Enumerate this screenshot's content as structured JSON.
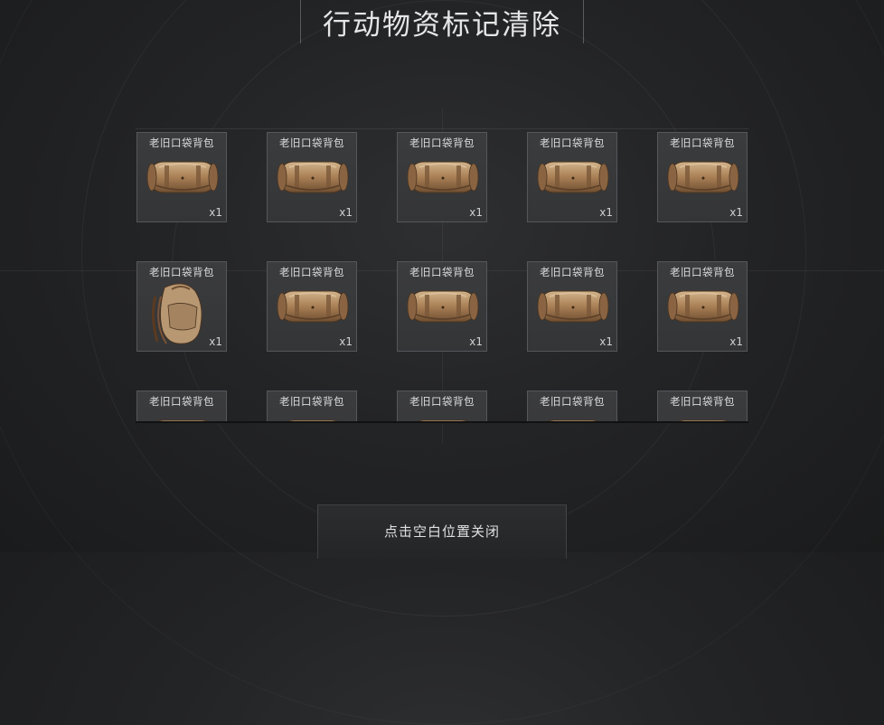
{
  "header": {
    "title": "行动物资标记清除"
  },
  "items": [
    {
      "name": "老旧口袋背包",
      "qty": "x1",
      "icon": "duffel-bag-icon"
    },
    {
      "name": "老旧口袋背包",
      "qty": "x1",
      "icon": "duffel-bag-icon"
    },
    {
      "name": "老旧口袋背包",
      "qty": "x1",
      "icon": "duffel-bag-icon"
    },
    {
      "name": "老旧口袋背包",
      "qty": "x1",
      "icon": "duffel-bag-icon"
    },
    {
      "name": "老旧口袋背包",
      "qty": "x1",
      "icon": "duffel-bag-icon"
    },
    {
      "name": "老旧口袋背包",
      "qty": "x1",
      "icon": "backpack-icon"
    },
    {
      "name": "老旧口袋背包",
      "qty": "x1",
      "icon": "duffel-bag-icon"
    },
    {
      "name": "老旧口袋背包",
      "qty": "x1",
      "icon": "duffel-bag-icon"
    },
    {
      "name": "老旧口袋背包",
      "qty": "x1",
      "icon": "duffel-bag-icon"
    },
    {
      "name": "老旧口袋背包",
      "qty": "x1",
      "icon": "duffel-bag-icon"
    },
    {
      "name": "老旧口袋背包",
      "qty": "",
      "icon": "duffel-bag-icon"
    },
    {
      "name": "老旧口袋背包",
      "qty": "",
      "icon": "duffel-bag-icon"
    },
    {
      "name": "老旧口袋背包",
      "qty": "",
      "icon": "duffel-bag-icon"
    },
    {
      "name": "老旧口袋背包",
      "qty": "",
      "icon": "duffel-bag-icon"
    },
    {
      "name": "老旧口袋背包",
      "qty": "",
      "icon": "duffel-bag-icon"
    }
  ],
  "footer": {
    "close_label": "点击空白位置关闭"
  },
  "colors": {
    "background": "#232426",
    "tile": "#3a3b3d",
    "tile_border": "#55575a",
    "bag": "#b08a62"
  }
}
